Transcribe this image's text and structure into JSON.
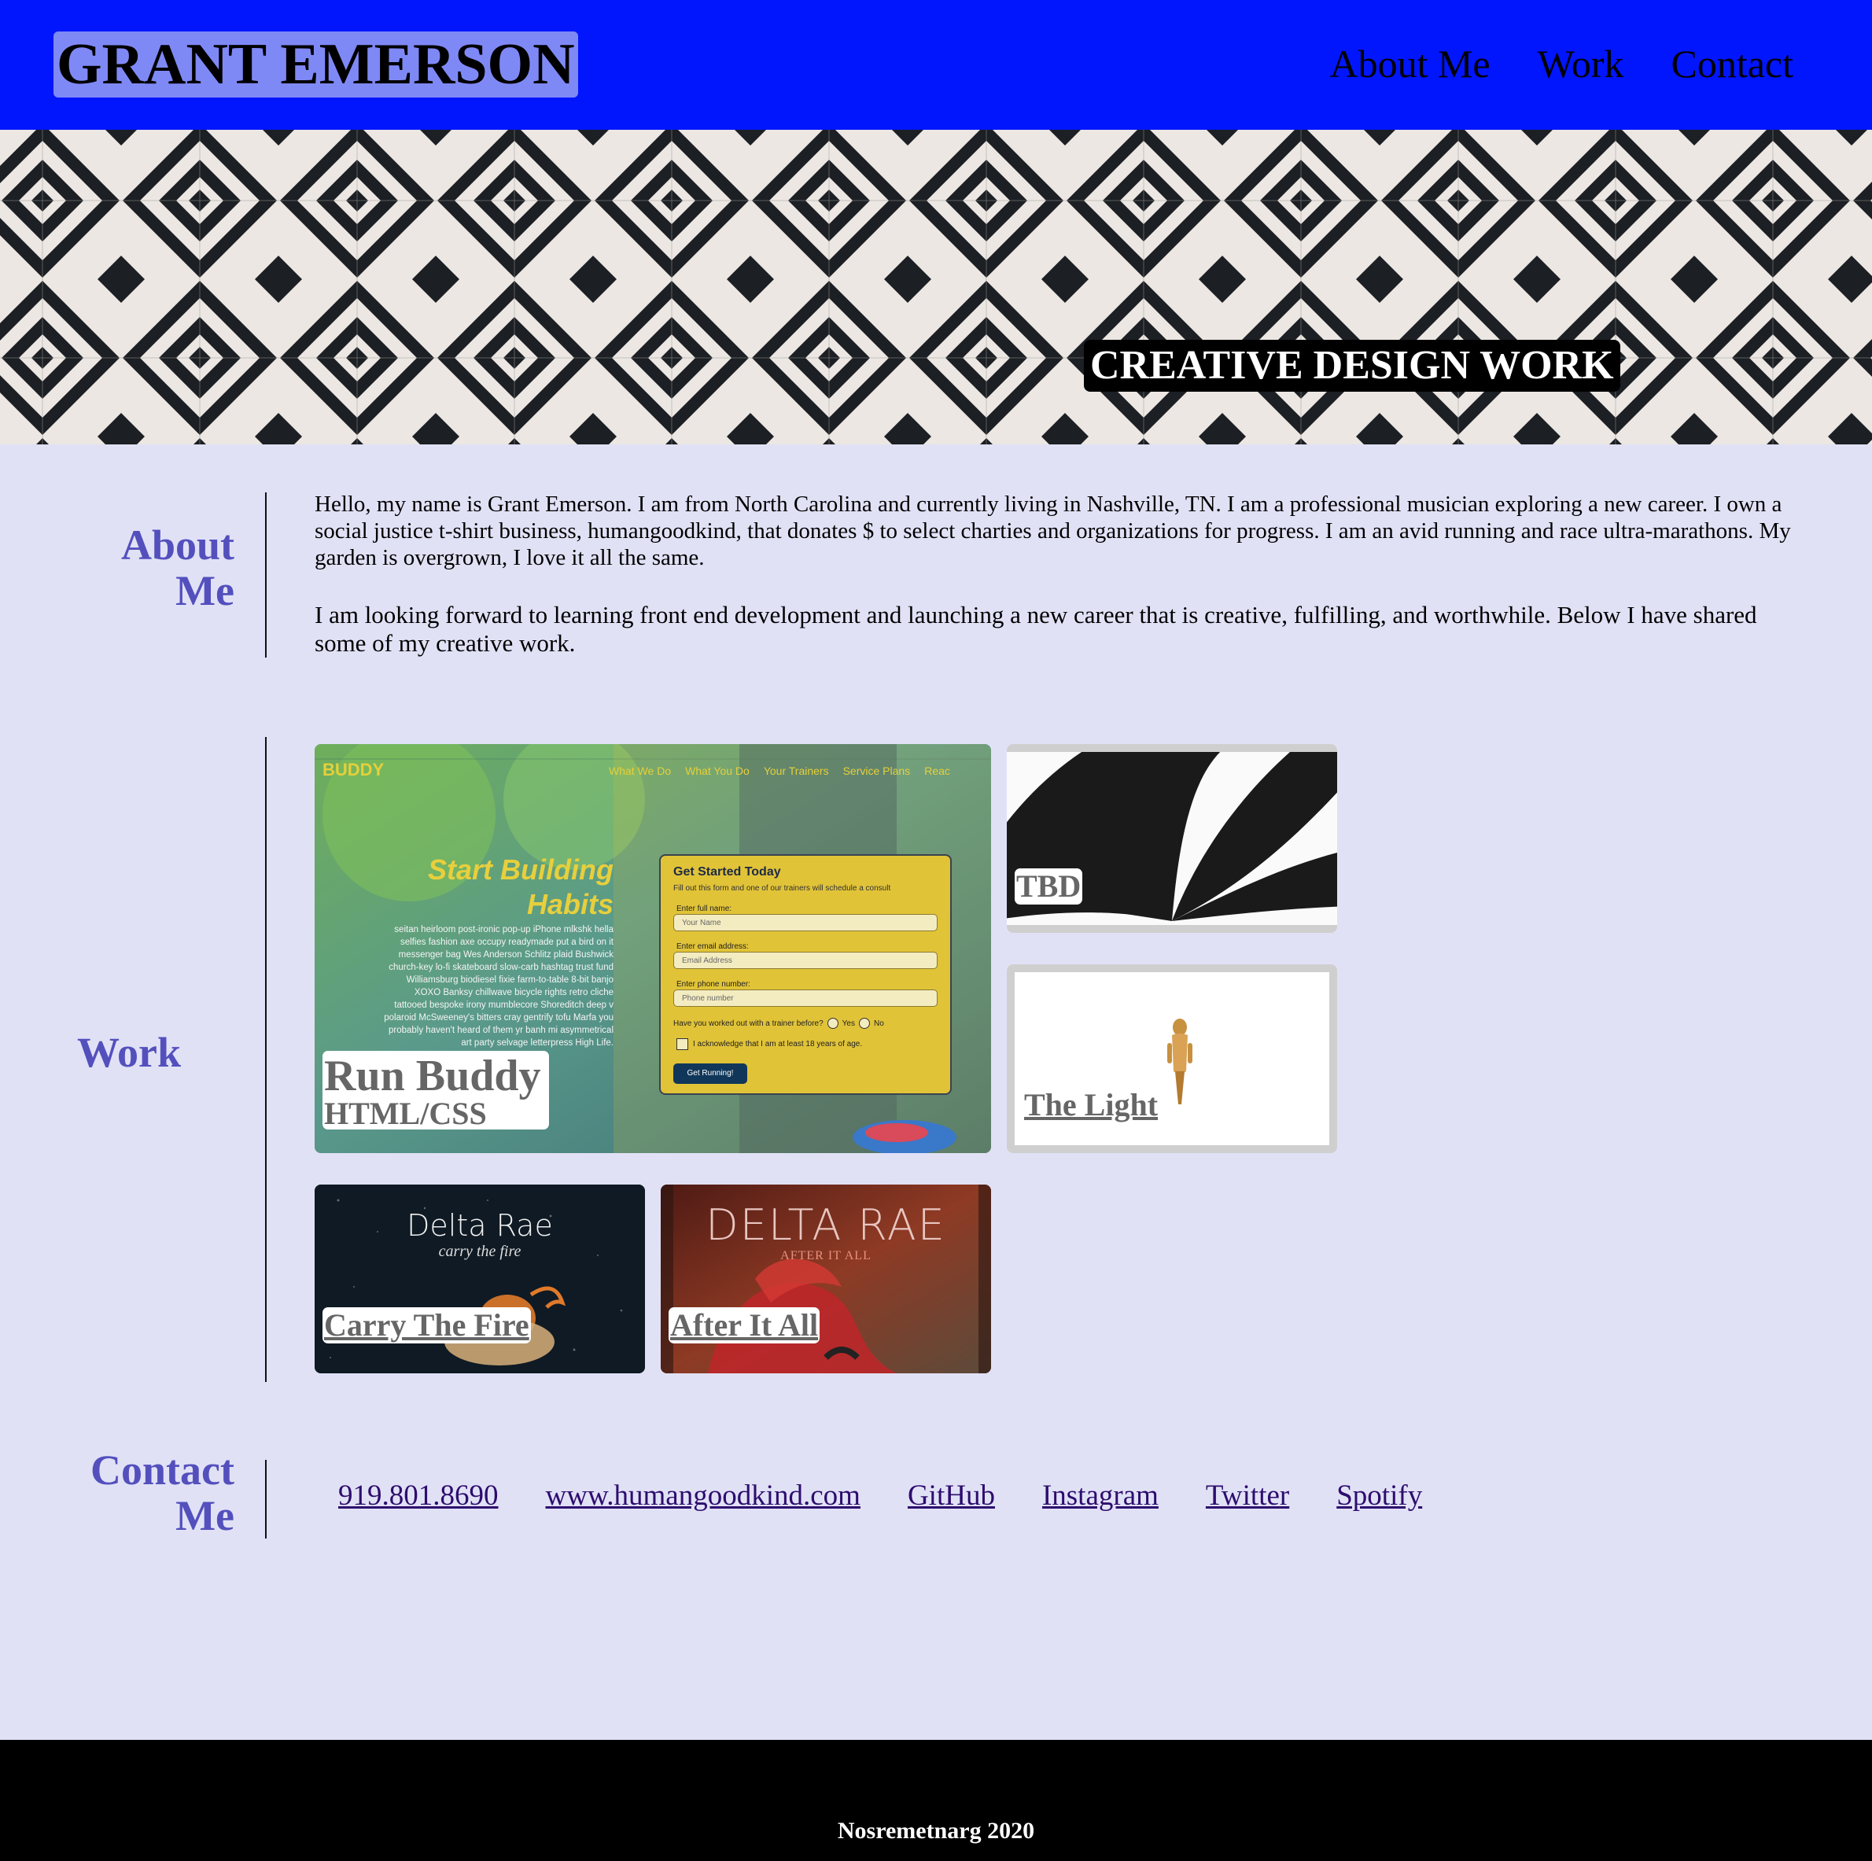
{
  "header": {
    "title": "GRANT EMERSON",
    "nav": [
      "About Me",
      "Work",
      "Contact"
    ]
  },
  "hero": {
    "caption": "CREATIVE DESIGN WORK",
    "pattern": "black-and-white diamond tile pattern"
  },
  "about": {
    "heading_line1": "About",
    "heading_line2": "Me",
    "paragraphs": [
      "Hello, my name is Grant Emerson. I am from North Carolina and currently living in Nashville, TN. I am a professional musician exploring a new career. I own a social justice t-shirt business, humangoodkind, that donates $ to select charties and organizations for progress. I am an avid running and race ultra-marathons. My garden is overgrown, I love it all the same.",
      "I am looking forward to learning front end development and launching a new career that is creative, fulfilling, and worthwhile. Below I have shared some of my creative work."
    ]
  },
  "work": {
    "heading": "Work",
    "featured": {
      "title": "Run Buddy",
      "subtitle": "HTML/CSS",
      "preview": {
        "brand": "BUDDY",
        "nav": [
          "What We Do",
          "What You Do",
          "Your Trainers",
          "Service Plans",
          "Reac"
        ],
        "headline1": "Start Building",
        "headline2": "Habits",
        "body_lines": [
          "seitan heirloom post-ironic pop-up iPhone mlkshk hella",
          "selfies fashion axe occupy readymade put a bird on it",
          "messenger bag Wes Anderson Schlitz plaid Bushwick",
          "church-key lo-fi skateboard slow-carb hashtag trust fund",
          "Williamsburg biodiesel fixie farm-to-table 8-bit banjo",
          "XOXO Banksy chillwave bicycle rights retro cliche",
          "tattooed bespoke irony mumblecore Shoreditch deep v",
          "polaroid McSweeney's bitters cray gentrify tofu Marfa you",
          "probably haven't heard of them yr banh mi asymmetrical",
          "art party selvage letterpress High Life."
        ],
        "form_title": "Get Started Today",
        "form_sub": "Fill out this form and one of our trainers will schedule a consult",
        "name_label": "Enter full name:",
        "name_placeholder": "Your Name",
        "email_label": "Enter email address:",
        "email_placeholder": "Email Address",
        "phone_label": "Enter phone number:",
        "phone_placeholder": "Phone number",
        "question": "Have you worked out with a trainer before?",
        "yes": "Yes",
        "no": "No",
        "ack": "I acknowledge that I am at least 18 years of age.",
        "button": "Get Running!"
      }
    },
    "tiles": [
      {
        "title": "TBD"
      },
      {
        "title": "The Light"
      },
      {
        "title": "Carry The Fire",
        "album_artist": "Delta Rae",
        "album_sub": "carry the fire"
      },
      {
        "title": "After It All",
        "album_artist": "DELTA RAE",
        "album_sub": "AFTER IT ALL"
      }
    ]
  },
  "contact": {
    "heading_line1": "Contact",
    "heading_line2": "Me",
    "links": [
      "919.801.8690",
      "www.humangoodkind.com",
      "GitHub",
      "Instagram",
      "Twitter",
      "Spotify"
    ]
  },
  "footer": {
    "text": "Nosremetnarg 2020"
  },
  "colors": {
    "header_bg": "#0116fc",
    "title_highlight": "#7f89f6",
    "page_bg": "#e1e1f6",
    "section_heading": "#5350bd",
    "link": "#2d0d6e",
    "footer_bg": "#000000"
  }
}
